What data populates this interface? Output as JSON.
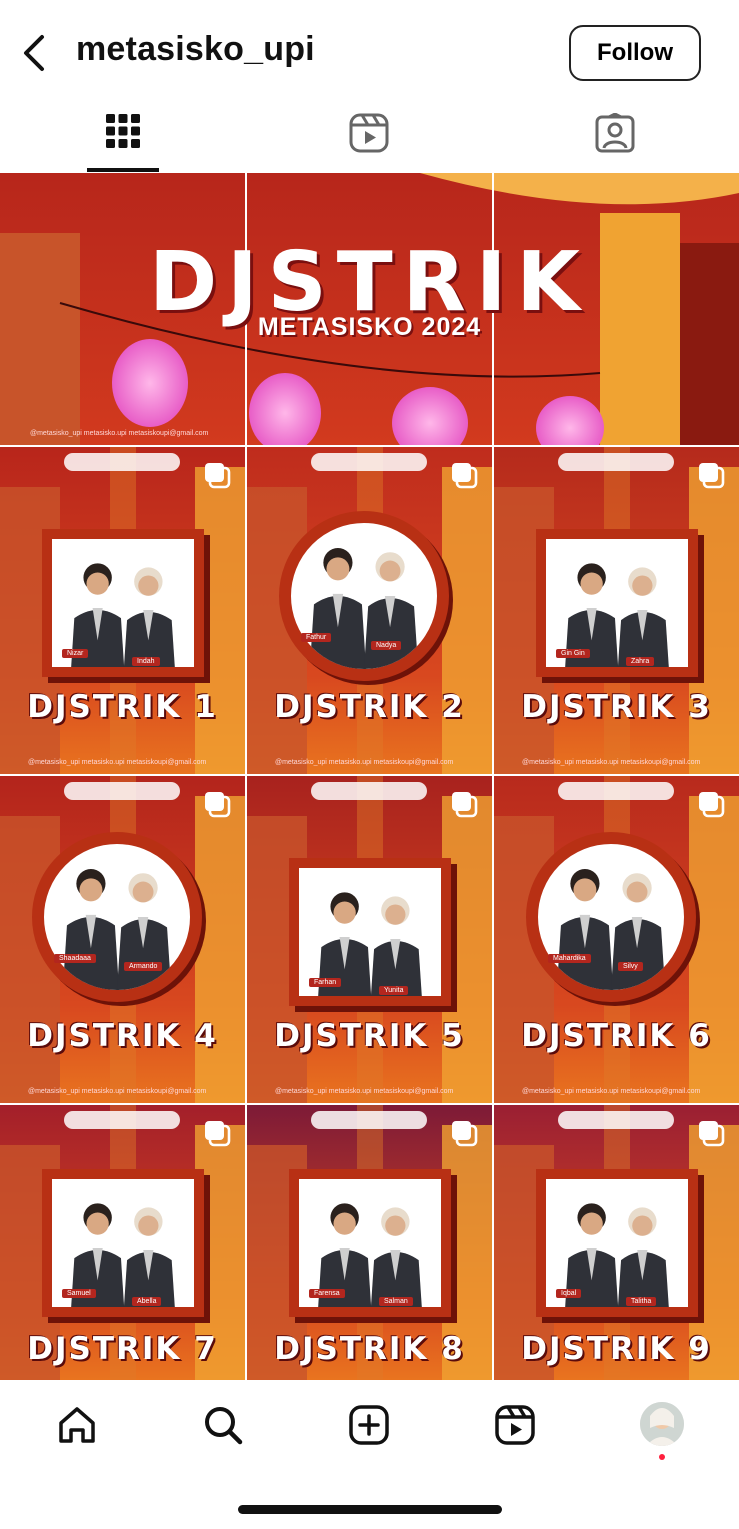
{
  "header": {
    "username": "metasisko_upi",
    "follow_label": "Follow"
  },
  "tabs": [
    {
      "name": "posts-grid",
      "icon": "grid-icon",
      "active": true
    },
    {
      "name": "reels",
      "icon": "reels-icon",
      "active": false
    },
    {
      "name": "tagged",
      "icon": "tagged-person-icon",
      "active": false
    }
  ],
  "banner": {
    "title": "DJSTRIK",
    "subtitle": "METASISKO 2024"
  },
  "posts": [
    {
      "label": "DJSTRIK 1",
      "frame": "square",
      "names": [
        "Nizar",
        "Indah"
      ]
    },
    {
      "label": "DJSTRIK 2",
      "frame": "circle",
      "names": [
        "Fathur",
        "Nadya"
      ]
    },
    {
      "label": "DJSTRIK 3",
      "frame": "square",
      "names": [
        "Gin Gin",
        "Zahra"
      ]
    },
    {
      "label": "DJSTRIK 4",
      "frame": "circle",
      "names": [
        "Shaadaaa",
        "Armando"
      ]
    },
    {
      "label": "DJSTRIK 5",
      "frame": "square",
      "names": [
        "Farhan",
        "Yunita"
      ]
    },
    {
      "label": "DJSTRIK 6",
      "frame": "circle",
      "names": [
        "Mahardika",
        "Silvy"
      ]
    },
    {
      "label": "DJSTRIK 7",
      "frame": "square",
      "names": [
        "Samuel",
        "Abella"
      ]
    },
    {
      "label": "DJSTRIK 8",
      "frame": "square",
      "names": [
        "Farensa",
        "Salman"
      ]
    },
    {
      "label": "DJSTRIK 9",
      "frame": "square",
      "names": [
        "Iqbal",
        "Talitha"
      ]
    }
  ],
  "footer_text": "@metasisko_upi   metasisko.upi   metasiskoupi@gmail.com",
  "colors": {
    "accent_red": "#b83014",
    "bg_red": "#c0241a",
    "notification_dot": "#ff1f3d"
  },
  "bottom_nav": [
    {
      "name": "home",
      "icon": "home-icon"
    },
    {
      "name": "search",
      "icon": "search-icon"
    },
    {
      "name": "create",
      "icon": "create-plus-icon"
    },
    {
      "name": "reels",
      "icon": "reels-icon"
    },
    {
      "name": "profile",
      "icon": "profile-avatar-icon"
    }
  ]
}
